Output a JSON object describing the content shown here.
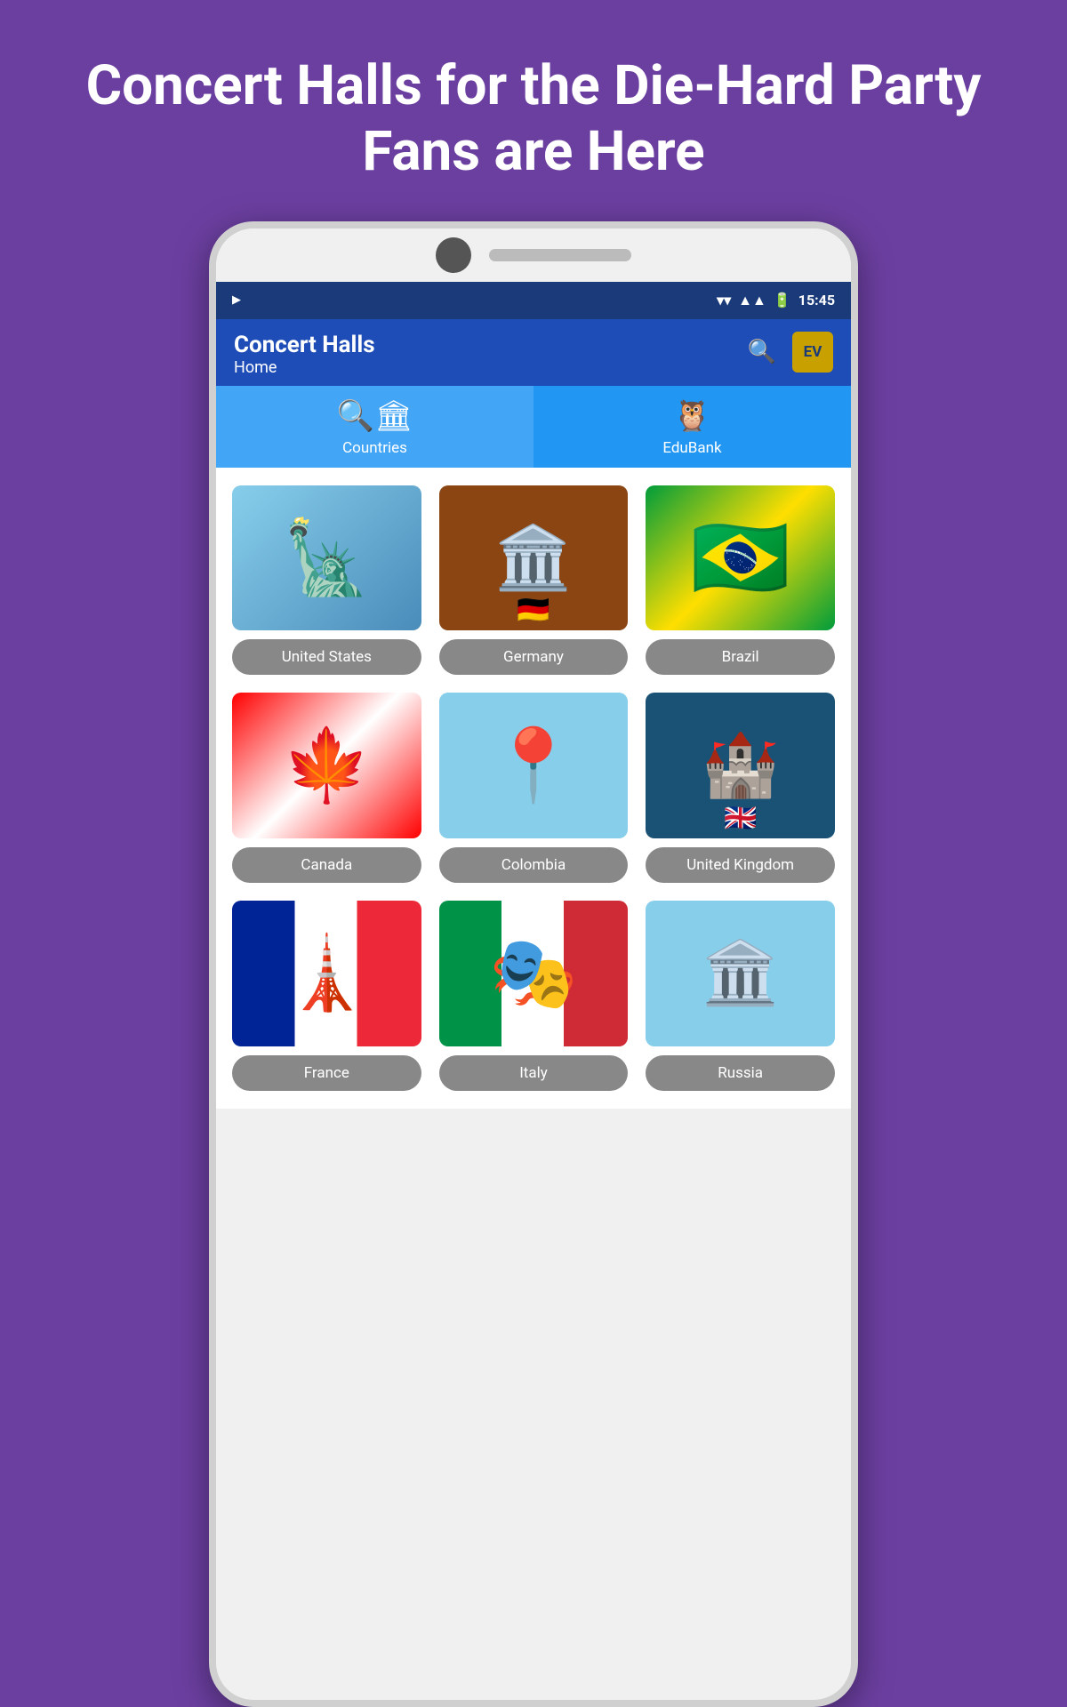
{
  "hero": {
    "title": "Concert Halls for the Die-Hard Party Fans are Here"
  },
  "statusBar": {
    "time": "15:45"
  },
  "appBar": {
    "title": "Concert Halls",
    "subtitle": "Home",
    "badge": "EV"
  },
  "tabs": [
    {
      "id": "countries",
      "label": "Countries",
      "active": true
    },
    {
      "id": "edubank",
      "label": "EduBank",
      "active": false
    }
  ],
  "countries": [
    {
      "name": "United States",
      "imgClass": "img-usa"
    },
    {
      "name": "Germany",
      "imgClass": "img-germany"
    },
    {
      "name": "Brazil",
      "imgClass": "img-brazil"
    },
    {
      "name": "Canada",
      "imgClass": "img-canada"
    },
    {
      "name": "Colombia",
      "imgClass": "img-colombia"
    },
    {
      "name": "United Kingdom",
      "imgClass": "img-uk"
    },
    {
      "name": "France",
      "imgClass": "img-france"
    },
    {
      "name": "Italy",
      "imgClass": "img-italy"
    },
    {
      "name": "Russia",
      "imgClass": "img-russia"
    }
  ]
}
